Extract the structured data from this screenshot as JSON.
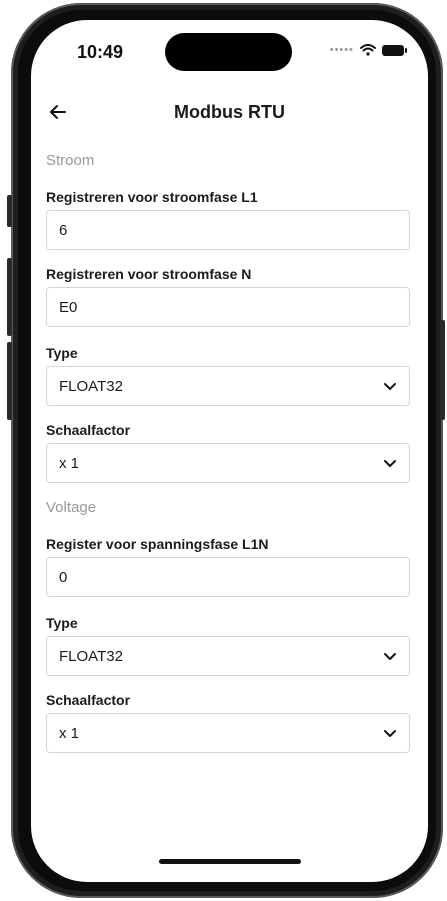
{
  "status": {
    "time": "10:49"
  },
  "header": {
    "title": "Modbus RTU"
  },
  "sections": {
    "current": {
      "heading": "Stroom",
      "l1": {
        "label": "Registreren voor stroomfase L1",
        "value": "6"
      },
      "n": {
        "label": "Registreren voor stroomfase N",
        "value": "E0"
      },
      "type": {
        "label": "Type",
        "value": "FLOAT32"
      },
      "scale": {
        "label": "Schaalfactor",
        "value": "x 1"
      }
    },
    "voltage": {
      "heading": "Voltage",
      "l1n": {
        "label": "Register voor spanningsfase L1N",
        "value": "0"
      },
      "type": {
        "label": "Type",
        "value": "FLOAT32"
      },
      "scale": {
        "label": "Schaalfactor",
        "value": "x 1"
      }
    }
  },
  "icons": {
    "back": "arrow-left-icon",
    "dropdown": "chevron-down-icon",
    "wifi": "wifi-icon",
    "battery": "battery-icon"
  }
}
